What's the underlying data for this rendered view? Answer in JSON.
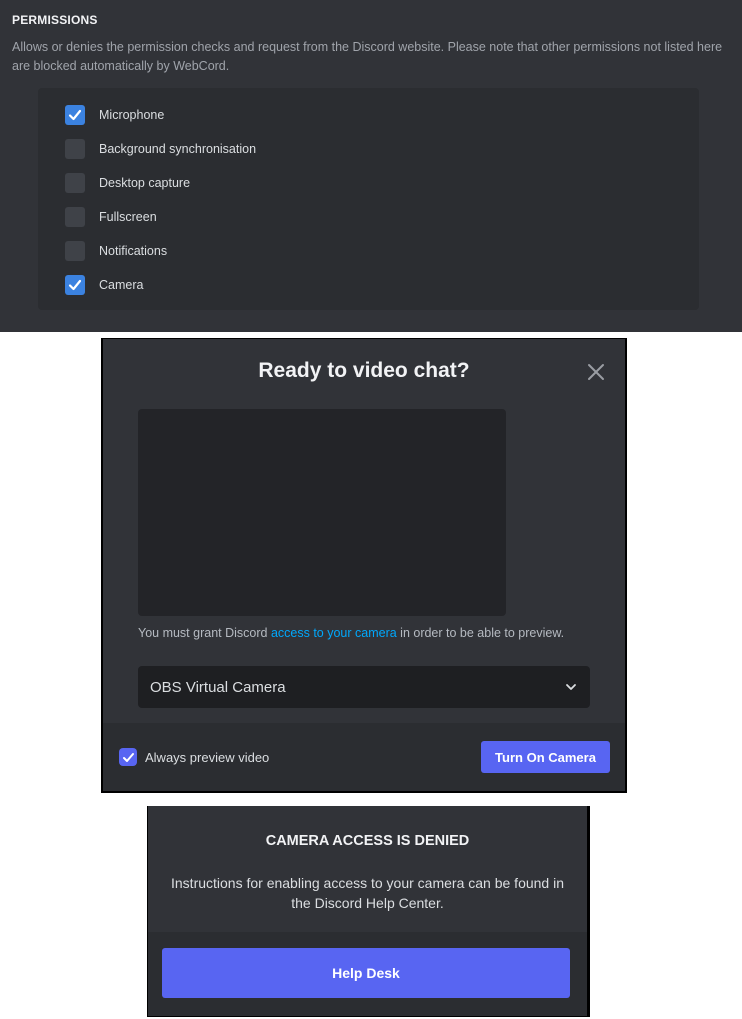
{
  "permissions": {
    "title": "PERMISSIONS",
    "description": "Allows or denies the permission checks and request from the Discord website. Please note that other permissions not listed here are blocked automatically by WebCord.",
    "items": [
      {
        "label": "Microphone",
        "checked": true
      },
      {
        "label": "Background synchronisation",
        "checked": false
      },
      {
        "label": "Desktop capture",
        "checked": false
      },
      {
        "label": "Fullscreen",
        "checked": false
      },
      {
        "label": "Notifications",
        "checked": false
      },
      {
        "label": "Camera",
        "checked": true
      }
    ]
  },
  "video_modal": {
    "title": "Ready to video chat?",
    "note_prefix": "You must grant Discord ",
    "note_link": "access to your camera",
    "note_suffix": " in order to be able to preview.",
    "camera_select_value": "OBS Virtual Camera",
    "always_preview_label": "Always preview video",
    "always_preview_checked": true,
    "turn_on_button": "Turn On Camera"
  },
  "camera_denied": {
    "title": "CAMERA ACCESS IS DENIED",
    "text": "Instructions for enabling access to your camera can be found in the Discord Help Center.",
    "button": "Help Desk"
  },
  "colors": {
    "accent": "#5865f2",
    "checkbox_blue": "#3b82e0",
    "link": "#00a8fc",
    "panel_bg": "#313338"
  }
}
